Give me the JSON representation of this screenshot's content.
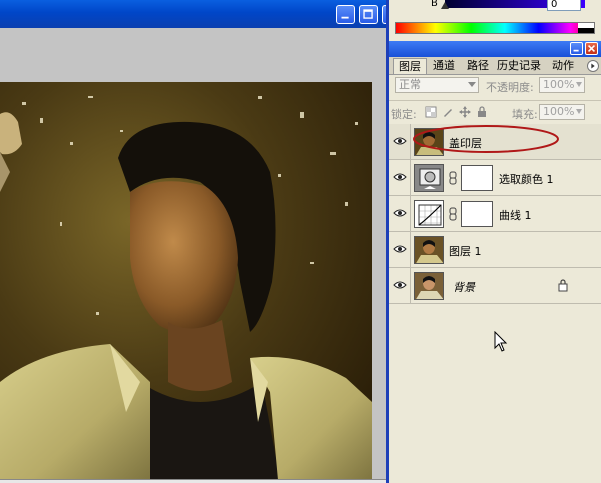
{
  "document_window": {
    "titlebar": {
      "buttons": [
        {
          "name": "minimize",
          "icon": "minimize-icon"
        },
        {
          "name": "maximize",
          "icon": "maximize-icon"
        },
        {
          "name": "close",
          "icon": "close-icon"
        }
      ]
    },
    "image": {
      "description_icon": "photo-canvas"
    }
  },
  "color_panel": {
    "channel_label": "B",
    "channel_value": "0"
  },
  "layers_panel": {
    "tabs": [
      {
        "label": "图层",
        "active": true
      },
      {
        "label": "通道",
        "active": false
      },
      {
        "label": "路径",
        "active": false
      },
      {
        "label": "历史记录",
        "active": false
      },
      {
        "label": "动作",
        "active": false
      }
    ],
    "blend_mode": "正常",
    "opacity_label": "不透明度:",
    "opacity_value": "100%",
    "lock_label": "锁定:",
    "fill_label": "填充:",
    "fill_value": "100%",
    "layers": [
      {
        "name": "盖印层",
        "type": "pixel",
        "selected": true,
        "italic": false
      },
      {
        "name": "选取颜色 1",
        "type": "adjustment-selective-color",
        "selected": false,
        "italic": false
      },
      {
        "name": "曲线 1",
        "type": "adjustment-curves",
        "selected": false,
        "italic": false
      },
      {
        "name": "图层 1",
        "type": "pixel",
        "selected": false,
        "italic": false
      },
      {
        "name": "背景",
        "type": "background",
        "selected": false,
        "italic": true,
        "locked": true
      }
    ]
  },
  "colors": {
    "xp_title_blue": "#0046c8",
    "panel_bg": "#ece9d8",
    "highlight_ellipse": "#b01818"
  }
}
